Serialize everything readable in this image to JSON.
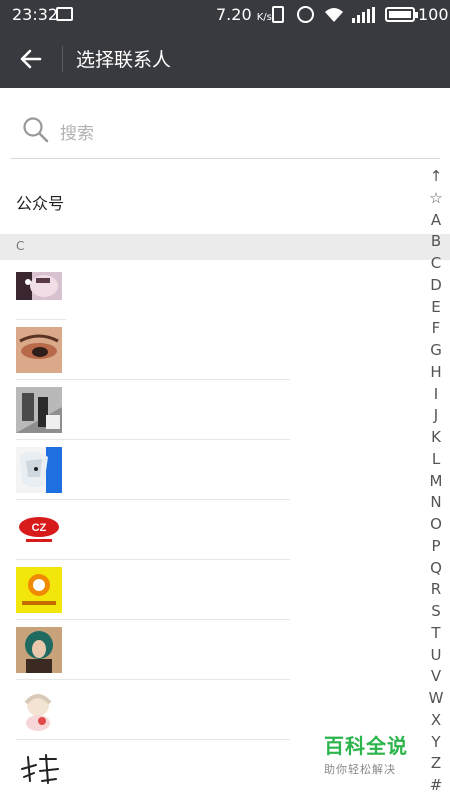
{
  "status_bar": {
    "time": "23:32",
    "network_speed": "7.20",
    "network_speed_unit": "K/s",
    "battery": "100"
  },
  "header": {
    "title": "选择联系人"
  },
  "search": {
    "placeholder": "搜索"
  },
  "public_accounts_label": "公众号",
  "section_header": "C",
  "contacts": [
    {
      "icon": "avatar-girl-portrait"
    },
    {
      "icon": "avatar-eye-makeup"
    },
    {
      "icon": "avatar-street-photo"
    },
    {
      "icon": "avatar-anime-character"
    },
    {
      "icon": "avatar-logo-badge"
    },
    {
      "icon": "avatar-yellow-logo"
    },
    {
      "icon": "avatar-green-hair-girl"
    },
    {
      "icon": "avatar-illustration-girl"
    },
    {
      "icon": "avatar-calligraphy"
    }
  ],
  "index_bar": [
    "↑",
    "☆",
    "A",
    "B",
    "C",
    "D",
    "E",
    "F",
    "G",
    "H",
    "I",
    "J",
    "K",
    "L",
    "M",
    "N",
    "O",
    "P",
    "Q",
    "R",
    "S",
    "T",
    "U",
    "V",
    "W",
    "X",
    "Y",
    "Z",
    "#"
  ],
  "watermark": {
    "line1": "百科全说",
    "line2": "助你轻松解决"
  },
  "colors": {
    "header_bg": "#393a3f",
    "accent_green": "#2cb54c"
  }
}
